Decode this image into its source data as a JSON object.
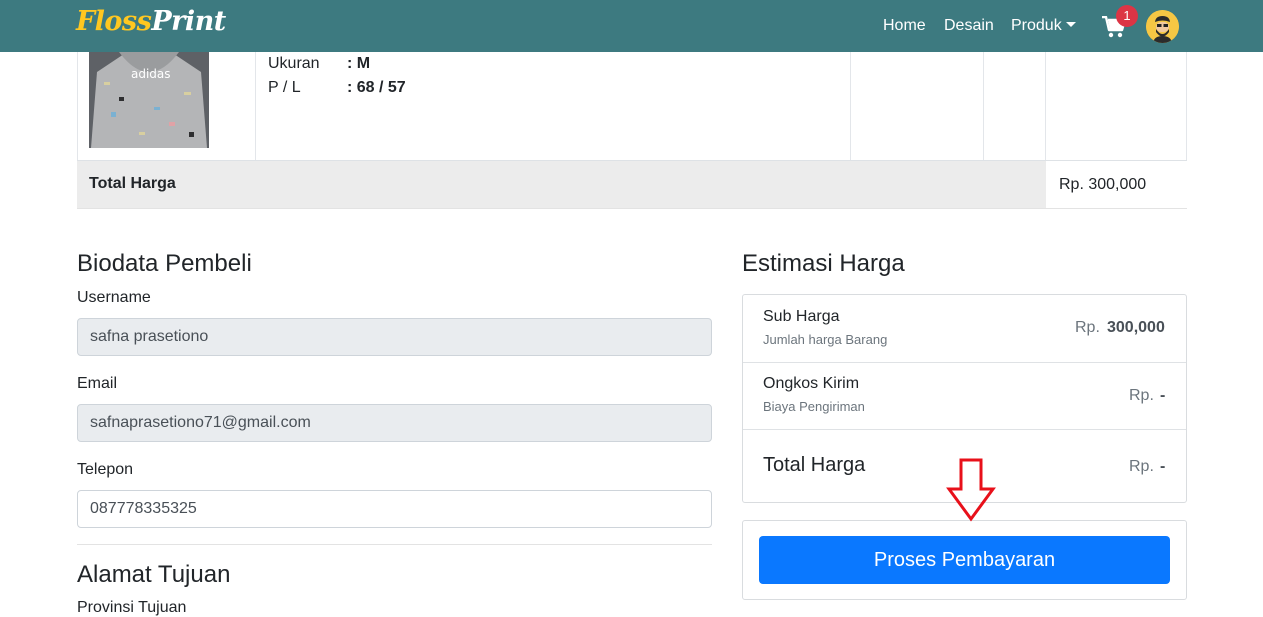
{
  "navbar": {
    "brand_part1": "Floss",
    "brand_part2": "Print",
    "links": {
      "home": "Home",
      "desain": "Desain",
      "produk": "Produk"
    },
    "cart_count": "1",
    "colors": {
      "background": "#3d7a80",
      "brand": "#ffc720",
      "badge": "#dc3545"
    }
  },
  "cart_item": {
    "attributes": [
      {
        "label": "Ukuran",
        "value": ": M"
      },
      {
        "label": "P / L",
        "value": ": 68 / 57"
      }
    ],
    "image_icon": "hoodie-product-photo",
    "total_label": "Total Harga",
    "total_value": "Rp. 300,000"
  },
  "biodata": {
    "title": "Biodata Pembeli",
    "fields": {
      "username": {
        "label": "Username",
        "value": "safna prasetiono"
      },
      "email": {
        "label": "Email",
        "value": "safnaprasetiono71@gmail.com"
      },
      "telepon": {
        "label": "Telepon",
        "value": "087778335325"
      }
    }
  },
  "alamat": {
    "title": "Alamat Tujuan",
    "provinsi_label": "Provinsi Tujuan"
  },
  "estimasi": {
    "title": "Estimasi Harga",
    "rows": [
      {
        "title": "Sub Harga",
        "subtitle": "Jumlah harga Barang",
        "currency": "Rp.",
        "amount": "300,000"
      },
      {
        "title": "Ongkos Kirim",
        "subtitle": "Biaya Pengiriman",
        "currency": "Rp.",
        "amount": "-"
      },
      {
        "title": "Total Harga",
        "subtitle": "",
        "currency": "Rp.",
        "amount": "-"
      }
    ],
    "button": "Proses Pembayaran",
    "button_color": "#0a78ff",
    "arrow_icon": "down-arrow-outline-icon",
    "arrow_color": "#e8101a"
  }
}
